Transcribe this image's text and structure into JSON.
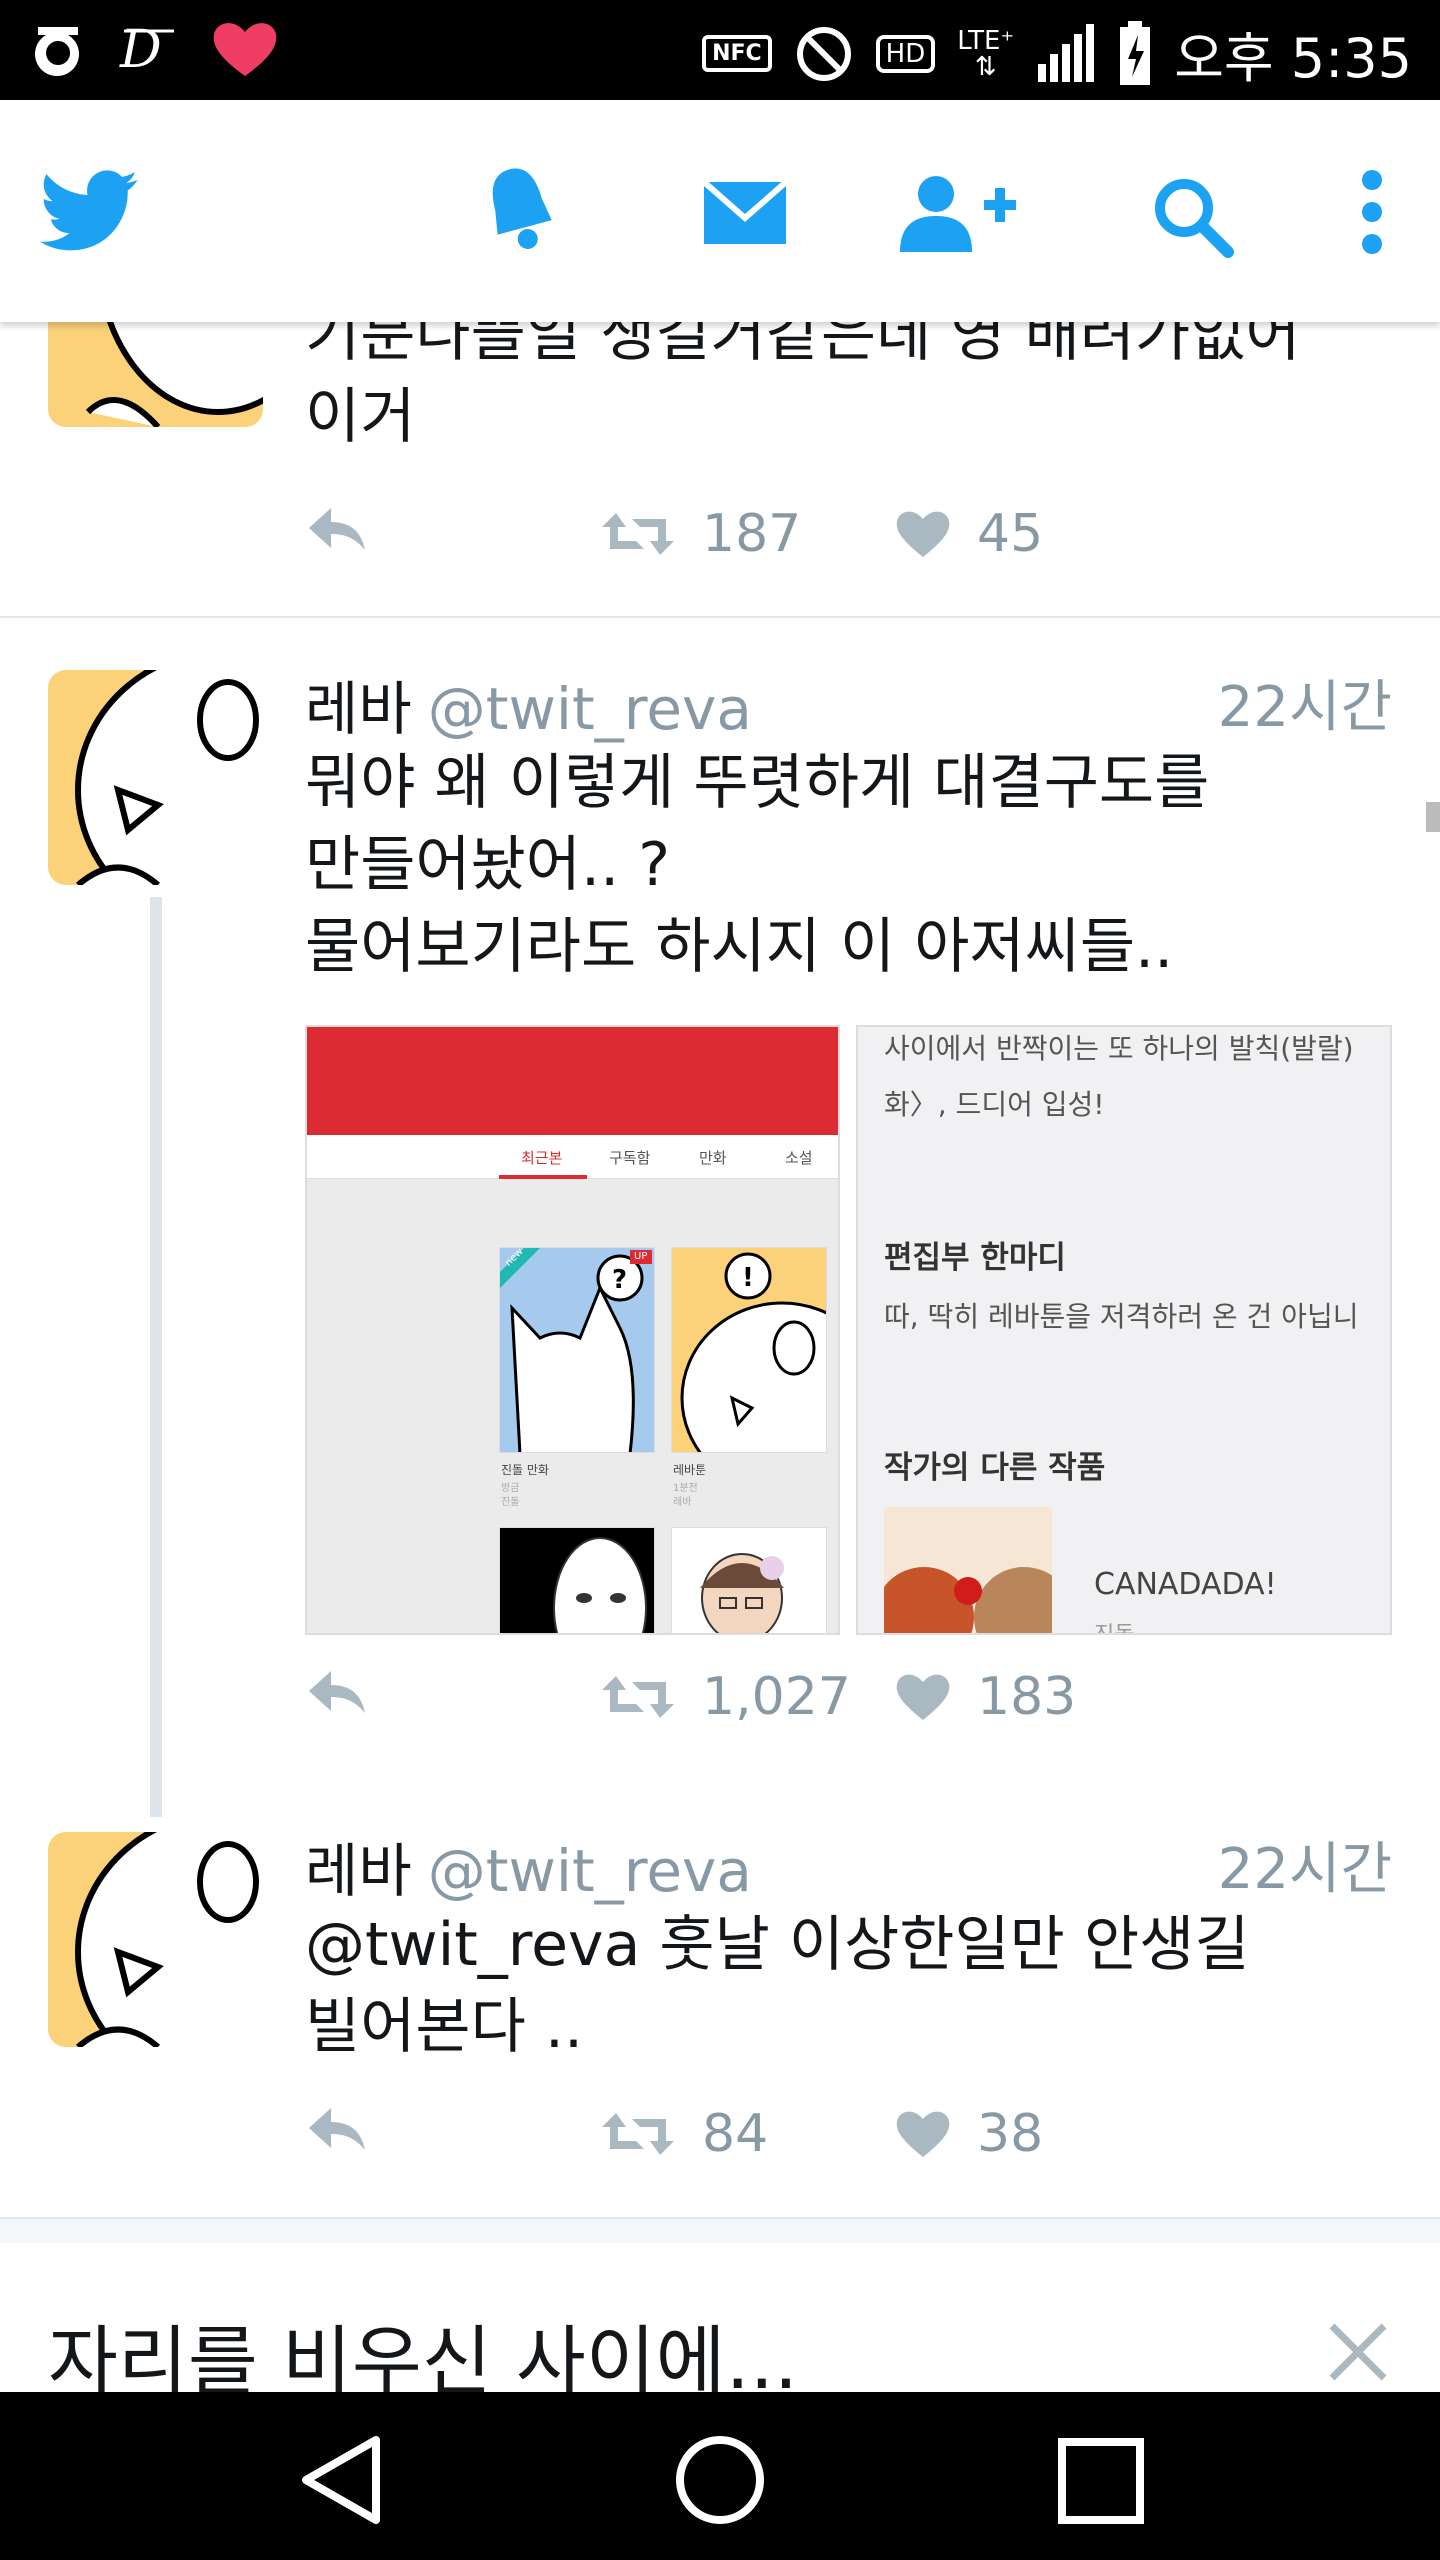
{
  "status_bar": {
    "time": "오후 5:35",
    "left_icons": [
      "o-app-icon",
      "d-app-icon",
      "heart-icon"
    ],
    "right_icons": [
      "nfc-icon",
      "do-not-disturb-icon",
      "hd-icon",
      "lte-icon",
      "signal-icon",
      "battery-charging-icon"
    ],
    "nfc_label": "NFC",
    "hd_label": "HD",
    "lte_label": "LTE⁺"
  },
  "app_bar": {
    "icons": [
      "twitter-bird-icon",
      "notifications-bell-icon",
      "messages-envelope-icon",
      "add-user-icon",
      "search-icon",
      "more-vert-icon"
    ],
    "accent_color": "#1da1f2"
  },
  "tweets": [
    {
      "text_lines": [
        "기분나쁠일 생길거같은데 영 배려가없어",
        "이거"
      ],
      "retweets": "187",
      "likes": "45"
    },
    {
      "name": "레바",
      "handle": "@twit_reva",
      "time": "22시간",
      "text_lines": [
        "뭐야 왜 이렇게 뚜렷하게 대결구도를",
        "만들어놨어.. ?",
        "물어보기라도 하시지 이 아저씨들.."
      ],
      "retweets": "1,027",
      "likes": "183",
      "media": {
        "left": {
          "tabs": [
            "최근본",
            "구독함",
            "만화",
            "소설"
          ],
          "items": [
            {
              "title": "진돌 만화",
              "sub1": "방금",
              "sub2": "진돌",
              "badge_left": "new",
              "badge_right": "UP"
            },
            {
              "title": "레바툰",
              "sub1": "1분전",
              "sub2": "레바"
            }
          ]
        },
        "right": {
          "lines": [
            "사이에서 반짝이는 또 하나의 발칙(발랄)",
            "화〉, 드디어 입성!"
          ],
          "heading1": "편집부 한마디",
          "line3": "따, 딱히 레바툰을 저격하러 온 건 아닙니",
          "heading2": "작가의 다른 작품",
          "work_title": "CANADADA!",
          "work_sub": "진돌"
        }
      }
    },
    {
      "name": "레바",
      "handle": "@twit_reva",
      "time": "22시간",
      "text_lines": [
        "@twit_reva 훗날 이상한일만 안생길",
        "빌어본다  .."
      ],
      "retweets": "84",
      "likes": "38"
    }
  ],
  "card": {
    "title": "자리를 비우신 사이에..."
  },
  "nav_bar": {
    "icons": [
      "back-triangle-icon",
      "home-circle-icon",
      "recents-square-icon"
    ]
  }
}
